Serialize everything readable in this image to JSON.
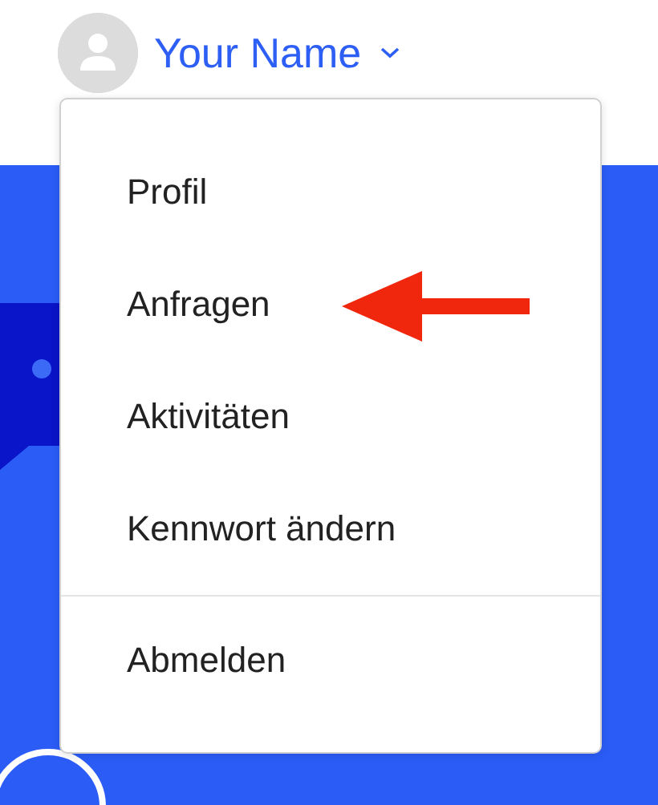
{
  "user": {
    "name": "Your Name"
  },
  "menu": {
    "items": [
      {
        "label": "Profil"
      },
      {
        "label": "Anfragen"
      },
      {
        "label": "Aktivitäten"
      },
      {
        "label": "Kennwort ändern"
      }
    ],
    "footer_items": [
      {
        "label": "Abmelden"
      }
    ]
  }
}
